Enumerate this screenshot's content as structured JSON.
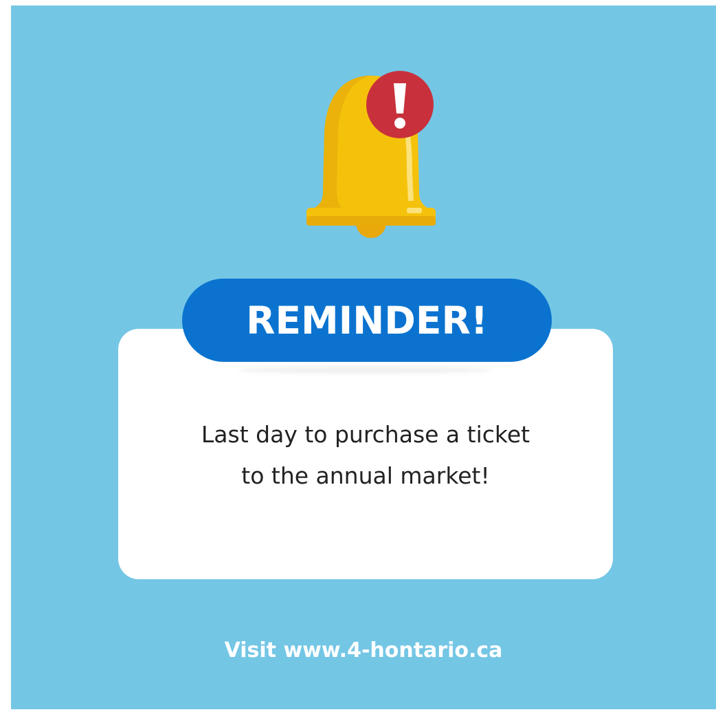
{
  "badge": {
    "label": "REMINDER!"
  },
  "message": {
    "line1": "Last day to purchase a ticket",
    "line2": "to the annual market!"
  },
  "footer": {
    "text": "Visit www.4-hontario.ca"
  },
  "icons": {
    "bell": "bell-icon",
    "alert": "exclamation-alert-icon"
  },
  "colors": {
    "background": "#74c6e5",
    "badge": "#0b73cf",
    "bell": "#f5c20b",
    "alert": "#c8313b",
    "card": "#ffffff"
  }
}
